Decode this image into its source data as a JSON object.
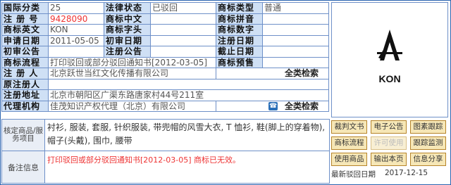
{
  "fields": {
    "category_label": "国际分类",
    "category_value": "25",
    "legal_status_label": "法律状态",
    "legal_status_value": "已驳回",
    "type_label": "商标类型",
    "type_value": "普通",
    "reg_no_label": "注 册 号",
    "reg_no_value": "9428090",
    "cn_name_label": "商标中文",
    "cn_name_value": "",
    "pinyin_label": "商标拼音",
    "pinyin_value": "",
    "en_label": "商标英文",
    "en_value": "KON",
    "initials_label": "商标字头",
    "initials_value": "",
    "digits_label": "商标数字",
    "digits_value": "",
    "apply_date_label": "申请日期",
    "apply_date_value": "2011-05-05",
    "prelim_date_label": "初审日期",
    "prelim_date_value": "",
    "reg_date_label": "注册日期",
    "reg_date_value": "",
    "prelim_notice_label": "初审公告",
    "prelim_notice_value": "",
    "reg_notice_label": "注册公告",
    "reg_notice_value": "",
    "deadline_label": "截止日期",
    "deadline_value": "",
    "flow_label": "商标流程",
    "flow_value": "打印驳回或部分驳回通知书[2012-03-05]",
    "presale_label": "商标预售",
    "presale_value": "",
    "registrant_label": "注 册 人",
    "registrant_value": "北京跃世当红文化传播有限公司",
    "search_all_1": "全类检索",
    "co_registrant_label": "原注册人",
    "co_registrant_value": "",
    "address_label": "注册地址",
    "address_value": "北京市朝阳区广渠东路唐家村44号211室",
    "agent_label": "代理机构",
    "agent_value": "佳茂知识产权代理（北京）有限公司",
    "search_all_2": "全类检索",
    "goods_label": "核定商品/服务项目",
    "goods_value": "衬衫, 服装, 套服, 针织服装, 带兜帽的风雪大衣, T 恤衫, 鞋(脚上的穿着物), 帽子(头戴), 围巾, 腰带",
    "note_label": "备注信息",
    "note_value": "打印驳回或部分驳回通知书[2012-03-05] 商标已无效。"
  },
  "logo": {
    "text": "KON"
  },
  "buttons": {
    "referee": "裁判文书",
    "e_notice": "电子公告",
    "image_track": "图素跟踪",
    "flow": "商标流程",
    "license": "许可使用",
    "track_monitor": "跟踪监测",
    "goods_used": "使用商品",
    "print_page": "输出本页",
    "share": "信息分享"
  },
  "footer": {
    "latest_review_label": "最新驳回日期",
    "latest_review_value": "2017-12-15"
  }
}
